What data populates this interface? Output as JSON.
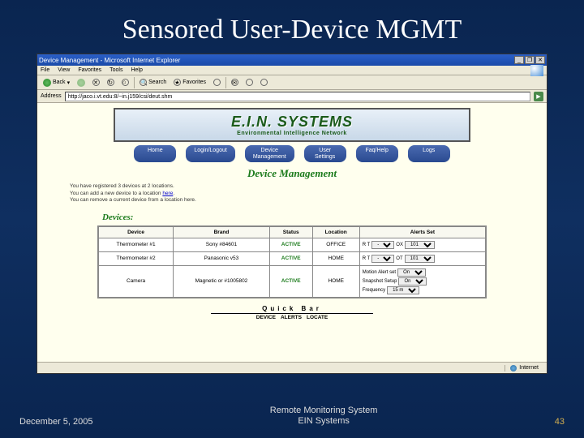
{
  "slide": {
    "title": "Sensored User-Device MGMT",
    "footer_left": "December 5, 2005",
    "footer_center_line1": "Remote Monitoring System",
    "footer_center_line2": "EIN Systems",
    "number": "43"
  },
  "browser": {
    "window_title": "Device Management - Microsoft Internet Explorer",
    "menus": [
      "File",
      "View",
      "Favorites",
      "Tools",
      "Help"
    ],
    "toolbar": {
      "back": "Back",
      "search": "Search",
      "favorites": "Favorites"
    },
    "address_label": "Address",
    "address_value": "http://jaco.i.vt.edu:8/~in.j159/csi/deut.shm",
    "status_zone": "Internet"
  },
  "page": {
    "banner_title": "E.I.N. SYSTEMS",
    "banner_subtitle": "Environmental Intelligence Network",
    "nav": [
      "Home",
      "Login/Logout",
      "Device\nManagement",
      "User\nSettings",
      "Faq/Help",
      "Logs"
    ],
    "heading": "Device Management",
    "intro_l1": "You have registered 3 devices at 2 locations.",
    "intro_l2_a": "You can add a new device to a location ",
    "intro_l2_link": "here",
    "intro_l2_b": ".",
    "intro_l3": "You can remove a current device from a location here.",
    "devices_heading": "Devices:",
    "table": {
      "headers": [
        "Device",
        "Brand",
        "Status",
        "Location",
        "Alerts Set"
      ],
      "rows": [
        {
          "device": "Thermometer #1",
          "brand": "Sony #84601",
          "status": "ACTIVE",
          "location": "OFFICE",
          "alerts": {
            "low_label": "R T",
            "low_val": "-",
            "high_label": "OX",
            "high_val": "101"
          }
        },
        {
          "device": "Thermometer #2",
          "brand": "Panasonic v53",
          "status": "ACTIVE",
          "location": "HOME",
          "alerts": {
            "low_label": "R T",
            "low_val": "-",
            "high_label": "OT",
            "high_val": "101"
          }
        },
        {
          "device": "Camera",
          "brand": "Magnetic or #1005802",
          "status": "ACTIVE",
          "location": "HOME",
          "alerts": {
            "motion_label": "Motion Alert set",
            "motion_val": "On",
            "snapshot_label": "Snapshot Setup",
            "snapshot_val": "On",
            "freq_label": "Frequency",
            "freq_val": "15 m"
          }
        }
      ]
    },
    "quickbar_title": "Quick Bar",
    "quickbar_links": [
      "DEVICE",
      "ALERTS",
      "LOCATE"
    ]
  }
}
